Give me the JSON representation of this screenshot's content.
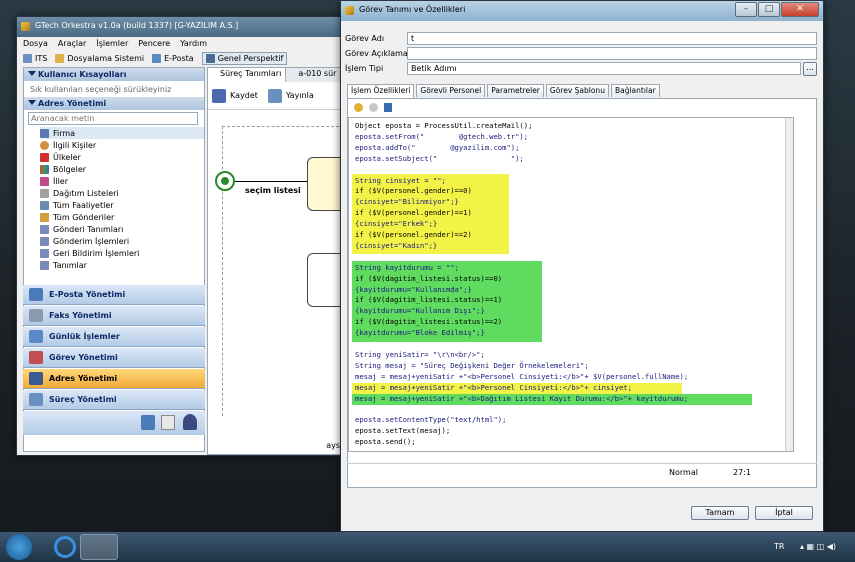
{
  "main_window": {
    "title": "GTech Orkestra v1.0a (build 1337) [G-YAZILIM A.S.]",
    "menu": [
      "Dosya",
      "Araçlar",
      "İşlemler",
      "Pencere",
      "Yardım"
    ],
    "toolbar": [
      "ITS",
      "Dosyalama Sistemi",
      "E-Posta",
      "Genel Perspektif"
    ],
    "user_shortcuts": {
      "title": "Kullanıcı Kısayolları",
      "hint": "Sık kullanılan seçeneği sürükleyiniz"
    },
    "address_panel": {
      "title": "Adres Yönetimi",
      "search_placeholder": "Aranacak metin",
      "items": [
        "Firma",
        "İlgili Kişiler",
        "Ülkeler",
        "Bölgeler",
        "İller",
        "Dağıtım Listeleri",
        "Tüm Faaliyetler",
        "Tüm Gönderiler",
        "Gönderi Tanımları",
        "Gönderim İşlemleri",
        "Geri Bildirim İşlemleri",
        "Tanımlar"
      ]
    },
    "nav": [
      "E-Posta Yönetimi",
      "Faks Yönetimi",
      "Günlük İşlemler",
      "Görev Yönetimi",
      "Adres Yönetimi",
      "Süreç Yönetimi"
    ],
    "editor_tabs": [
      "Süreç Tanımları",
      "a-010 sür"
    ],
    "editor_toolbar": [
      "Kaydet",
      "Yayınla"
    ],
    "diagram_label": "seçim listesi",
    "footer_text": "ays"
  },
  "dialog": {
    "title": "Görev Tanımı ve Özellikleri",
    "fields": {
      "name_label": "Görev Adı",
      "name_value": "t",
      "desc_label": "Görev Açıklaması",
      "desc_value": "",
      "type_label": "İşlem Tipi",
      "type_value": "Betik Adımı",
      "type_btn": "..."
    },
    "tabs": [
      "İşlem Özellikleri",
      "Görevli Personel",
      "Parametreler",
      "Görev Şablonu",
      "Bağlantılar"
    ],
    "code": [
      "Object eposta = ProcessUtil.createMail();",
      "eposta.setFrom(\"        @gtech.web.tr\");",
      "eposta.addTo(\"        @gyazilim.com\");",
      "eposta.setSubject(\"                 \");",
      "",
      "String cinsiyet = \"\";",
      "if ($V(personel.gender)==0)",
      "{cinsiyet=\"Bilinmiyor\";}",
      "if ($V(personel.gender)==1)",
      "{cinsiyet=\"Erkek\";}",
      "if ($V(personel.gender)==2)",
      "{cinsiyet=\"Kadın\";}",
      "",
      "String kayitdurumu = \"\";",
      "if ($V(dagitim_listesi.status)==0)",
      "{kayitdurumu=\"Kullanımda\";}",
      "if ($V(dagitim_listesi.status)==1)",
      "{kayitdurumu=\"Kullanım Dışı\";}",
      "if ($V(dagitim_listesi.status)==2)",
      "{kayitdurumu=\"Bloke Edilmiş\";}",
      "",
      "String yeniSatir= \"\\r\\n<br/>\";",
      "String mesaj = \"Süreç Değişkeni Değer Örnekelemeleri\";",
      "mesaj = mesaj+yeniSatir +\"<b>Personel Cinsiyeti:</b>\"+ $V(personel.fullName);",
      "mesaj = mesaj+yeniSatir +\"<b>Personel Cinsiyeti:</b>\"+ cinsiyet;",
      "mesaj = mesaj+yeniSatir +\"<b>Dağıtım Listesi Kayıt Durumu:</b>\"+ kayitdurumu;",
      "",
      "eposta.setContentType(\"text/html\");",
      "eposta.setText(mesaj);",
      "eposta.send();"
    ],
    "status": {
      "mode": "Normal",
      "pos": "27:1"
    },
    "buttons": {
      "ok": "Tamam",
      "cancel": "İptal"
    }
  },
  "taskbar": {
    "lang": "TR"
  }
}
